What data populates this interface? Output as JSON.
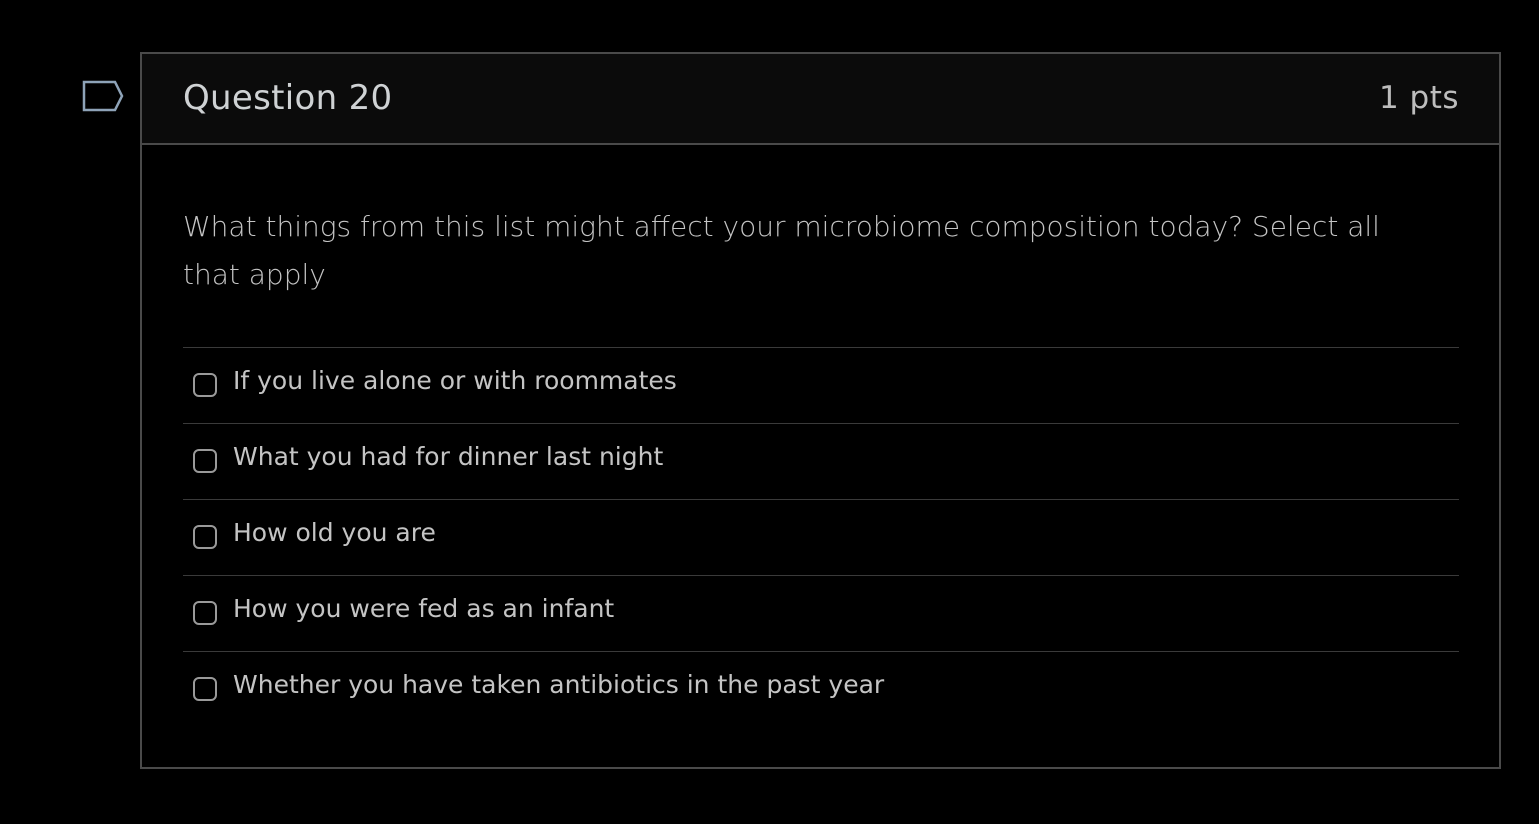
{
  "question": {
    "title": "Question 20",
    "points": "1 pts",
    "text": "What things from this list might affect your microbiome composition today? Select all that apply"
  },
  "flag_icon": "flag-bookmark-icon",
  "answers": [
    {
      "label": "If you live alone or with roommates",
      "checked": false
    },
    {
      "label": "What you had for dinner last night",
      "checked": false
    },
    {
      "label": "How old you are",
      "checked": false
    },
    {
      "label": "How you were fed as an infant",
      "checked": false
    },
    {
      "label": "Whether you have taken antibiotics in the past year",
      "checked": false
    }
  ],
  "colors": {
    "background": "#000000",
    "header_background": "#0b0b0b",
    "border": "#4a4a4a",
    "text": "#c4c4c4",
    "flag_outline": "#8ea3b8"
  }
}
